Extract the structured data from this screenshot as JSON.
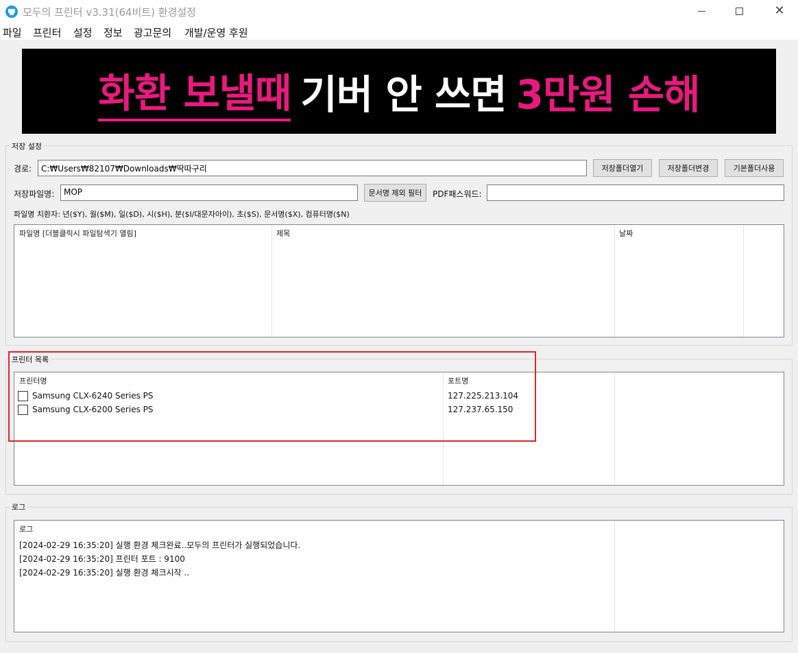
{
  "window": {
    "title": "모두의 프린터 v3.31(64비트) 환경설정",
    "app_icon": "printer-icon",
    "controls": {
      "minimize": "minimize-icon",
      "maximize": "maximize-icon",
      "close": "✕"
    }
  },
  "menu": {
    "items": [
      {
        "label": "파일"
      },
      {
        "label": "프린터"
      },
      {
        "label": "설정"
      },
      {
        "label": "정보"
      },
      {
        "label": "광고문의"
      },
      {
        "label": "개발/운영 후원"
      }
    ]
  },
  "banner": {
    "part1": "화환 보낼때",
    "part2": "기버 안 쓰면",
    "part3": "3만원 손해",
    "accent_color": "#e9197f"
  },
  "save_settings": {
    "group_label": "저장 설정",
    "path_label": "경로:",
    "path_value": "C:₩Users₩82107₩Downloads₩딱따구리",
    "open_folder_button": "저장폴더열기",
    "change_folder_button": "저장폴더변경",
    "default_folder_button": "기본폴더사용",
    "filename_label": "저장파일명:",
    "filename_value": "MOP",
    "filter_button": "문서명 제외 필터",
    "pdf_password_label": "PDF패스워드:",
    "pdf_password_value": "",
    "substitution_hint": "파일명 치환자: 년($Y), 월($M), 일($D), 시($H), 분($I/대문자아이), 초($S), 문서명($X), 컴퓨터명($N)",
    "file_list": {
      "columns": [
        "파일명 [더블클릭시 파일탐색기 열림]",
        "제목",
        "날짜"
      ],
      "rows": []
    }
  },
  "printer_list": {
    "group_label": "프린터 목록",
    "columns": [
      "프린터명",
      "포트명"
    ],
    "rows": [
      {
        "name": "Samsung CLX-6240 Series PS",
        "port": "127.225.213.104",
        "checked": false
      },
      {
        "name": "Samsung CLX-6200 Series PS",
        "port": "127.237.65.150",
        "checked": false
      }
    ],
    "highlight_color": "#d9262c"
  },
  "log": {
    "group_label": "로그",
    "column": "로그",
    "lines": [
      "[2024-02-29 16:35:20] 실행 환경 체크완료..모두의 프린터가 실행되었습니다.",
      "[2024-02-29 16:35:20] 프린터 포트 : 9100",
      "[2024-02-29 16:35:20] 실행 환경 체크시작 .."
    ]
  }
}
